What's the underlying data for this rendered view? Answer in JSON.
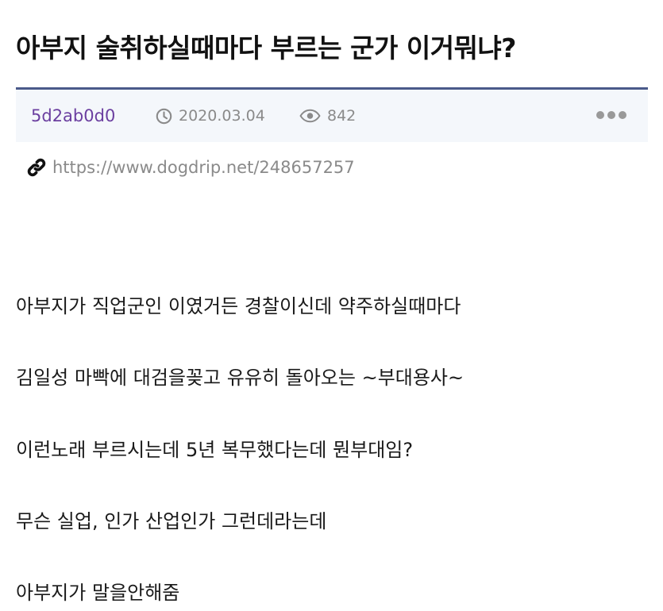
{
  "post": {
    "title": "아부지 술취하실때마다 부르는 군가 이거뭐냐?",
    "author": "5d2ab0d0",
    "date": "2020.03.04",
    "views": "842",
    "url": "https://www.dogdrip.net/248657257",
    "body": [
      "아부지가 직업군인 이였거든 경찰이신데 약주하실때마다",
      "김일성 마빡에 대검을꽂고 유유히 돌아오는 ~부대용사~",
      "이런노래 부르시는데 5년 복무했다는데 뭔부대임?",
      "무슨 실업, 인가 산업인가 그런데라는데",
      "아부지가 말을안해줌"
    ]
  },
  "icons": {
    "date": "clock-icon",
    "views": "eye-icon",
    "more": "more-dots-icon",
    "link": "link-icon"
  },
  "colors": {
    "author": "#6b3fa0",
    "meta_bar_background": "#f4f7fb",
    "meta_bar_border": "#4a5a8a",
    "muted_text": "#8a8a8a"
  }
}
